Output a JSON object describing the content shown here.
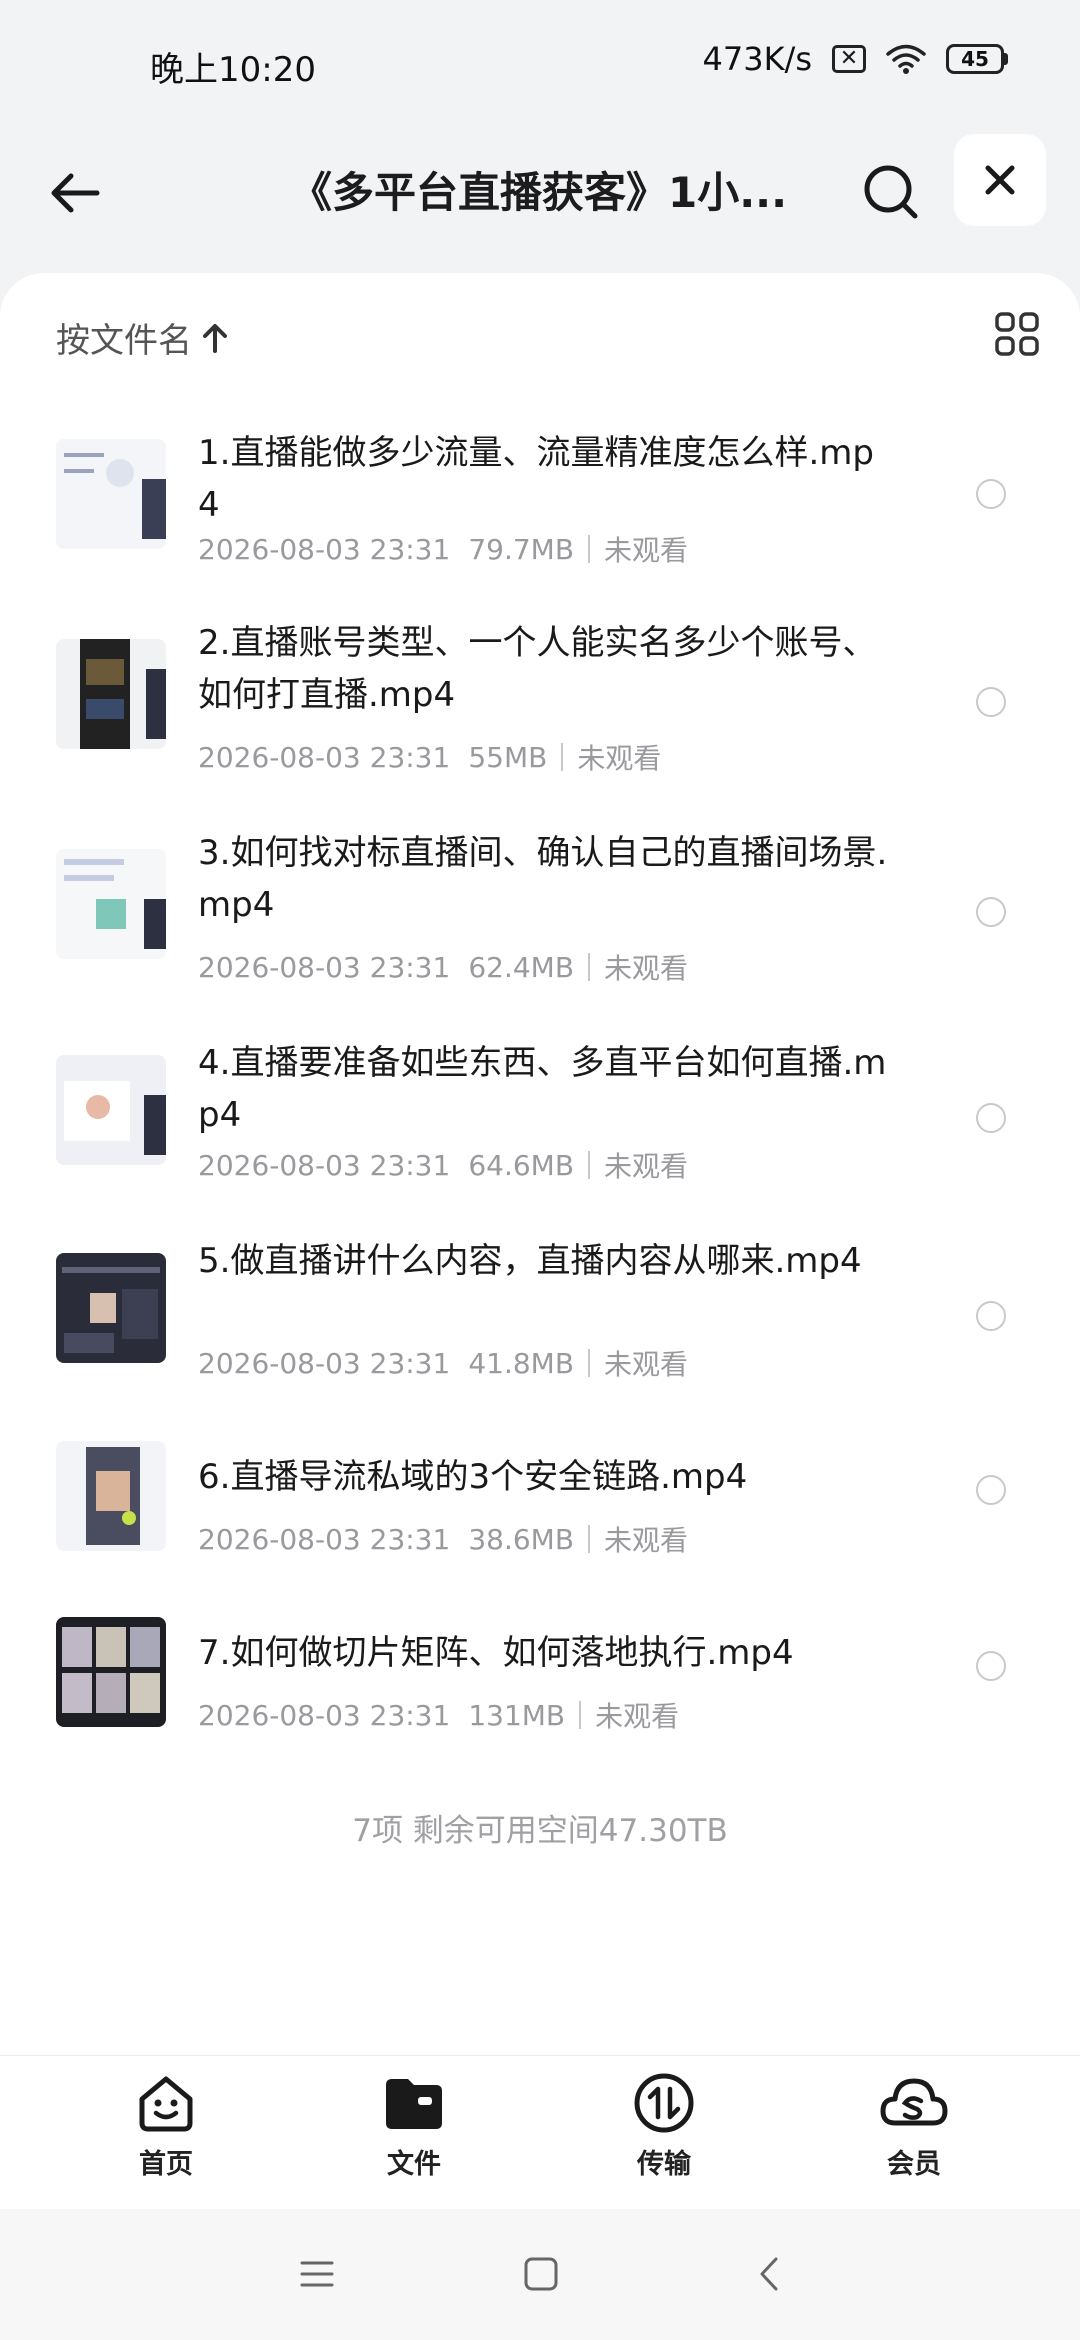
{
  "status_bar": {
    "time": "晚上10:20",
    "net_speed": "473K/s",
    "sim_icon": "sim-x-icon",
    "wifi_icon": "wifi-icon",
    "battery_level": "45"
  },
  "header": {
    "title": "《多平台直播获客》1小...",
    "back_icon": "arrow-left-icon",
    "search_icon": "search-icon",
    "close_icon": "close-icon"
  },
  "toolbar": {
    "sort_label": "按文件名",
    "sort_direction_icon": "arrow-up-icon",
    "view_toggle_icon": "grid-view-icon"
  },
  "files": [
    {
      "name": "1.直播能做多少流量、流量精准度怎么样.mp4",
      "date": "2026-08-03 23:31",
      "size": "79.7MB",
      "status": "未观看"
    },
    {
      "name": "2.直播账号类型、一个人能实名多少个账号、如何打直播.mp4",
      "date": "2026-08-03 23:31",
      "size": "55MB",
      "status": "未观看"
    },
    {
      "name": "3.如何找对标直播间、确认自己的直播间场景.mp4",
      "date": "2026-08-03 23:31",
      "size": "62.4MB",
      "status": "未观看"
    },
    {
      "name": "4.直播要准备如些东西、多直平台如何直播.mp4",
      "date": "2026-08-03 23:31",
      "size": "64.6MB",
      "status": "未观看"
    },
    {
      "name": "5.做直播讲什么内容，直播内容从哪来.mp4",
      "date": "2026-08-03 23:31",
      "size": "41.8MB",
      "status": "未观看"
    },
    {
      "name": "6.直播导流私域的3个安全链路.mp4",
      "date": "2026-08-03 23:31",
      "size": "38.6MB",
      "status": "未观看"
    },
    {
      "name": "7.如何做切片矩阵、如何落地执行.mp4",
      "date": "2026-08-03 23:31",
      "size": "131MB",
      "status": "未观看"
    }
  ],
  "summary": "7项 剩余可用空间47.30TB",
  "bottom_nav": [
    {
      "label": "首页",
      "icon": "home-smile-icon"
    },
    {
      "label": "文件",
      "icon": "folder-icon"
    },
    {
      "label": "传输",
      "icon": "transfer-icon"
    },
    {
      "label": "会员",
      "icon": "cloud-vip-icon"
    }
  ],
  "system_nav": {
    "menu_icon": "menu-icon",
    "home_icon": "square-home-icon",
    "back_icon": "chevron-left-icon"
  },
  "colors": {
    "background": "#f2f3f5",
    "card": "#ffffff",
    "text_primary": "#1a1a1a",
    "text_secondary": "#9a9a9e"
  }
}
